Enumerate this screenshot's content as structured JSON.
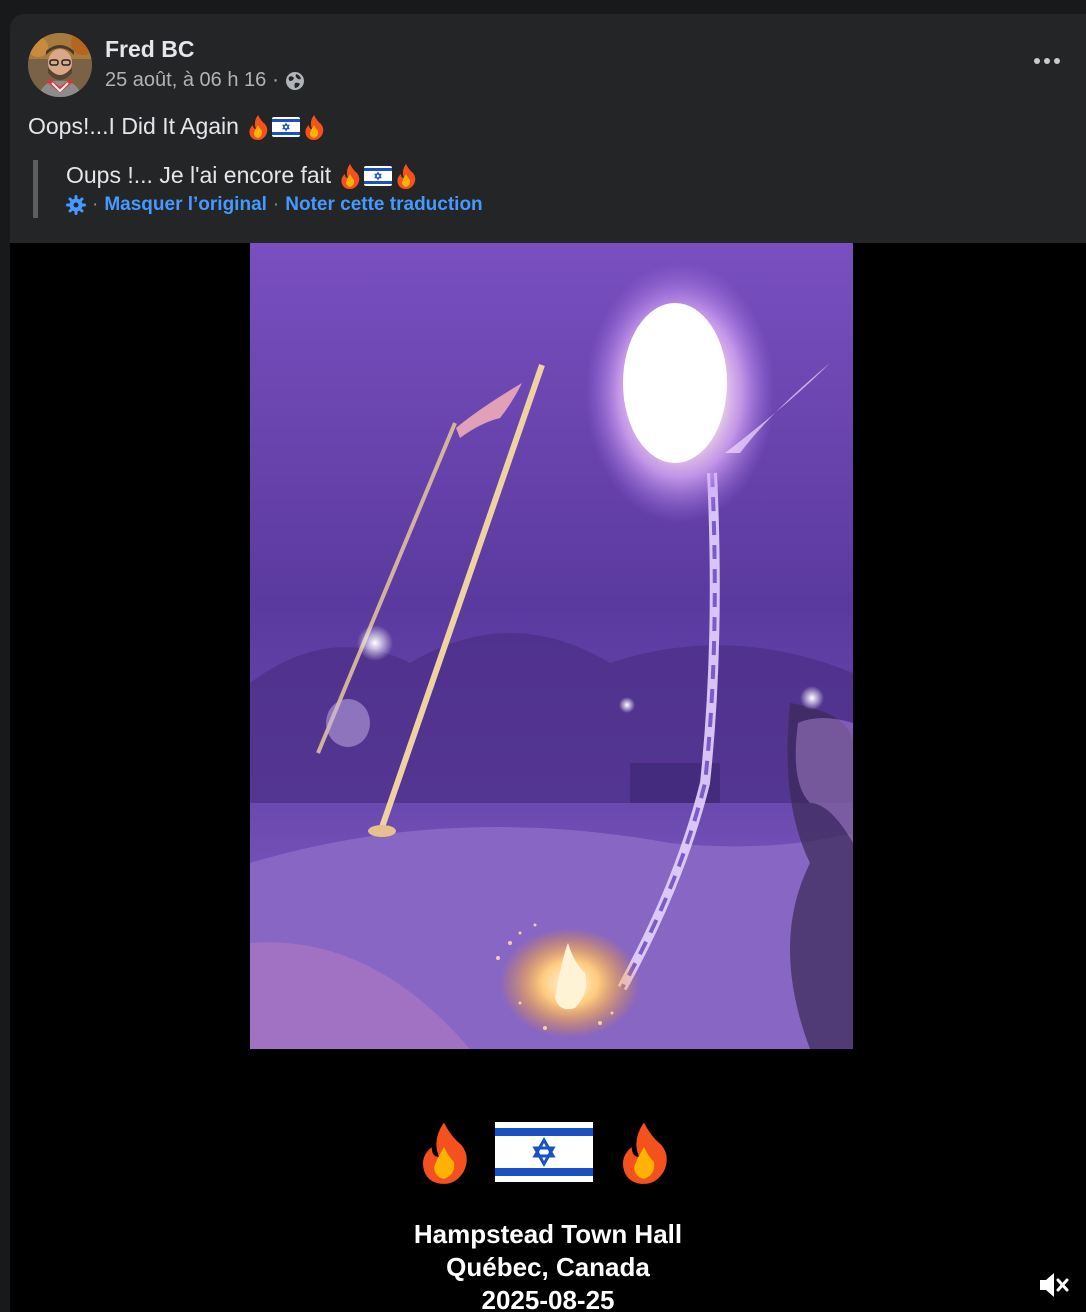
{
  "post": {
    "author": "Fred BC",
    "timestamp": "25 août, à 06 h 16",
    "separator": "·",
    "audience_icon": "globe-icon",
    "text": "Oops!...I Did It Again",
    "text_emojis": [
      "fire",
      "israel-flag",
      "fire"
    ]
  },
  "translation": {
    "text": "Oups !... Je l'ai encore fait",
    "settings_icon": "gear-icon",
    "separator": "·",
    "hide_original": "Masquer l’original",
    "rate_translation": "Noter cette traduction"
  },
  "video": {
    "overlay_emojis": [
      "fire",
      "israel-flag",
      "fire"
    ],
    "caption_line1": "Hampstead Town Hall",
    "caption_line2": "Québec, Canada",
    "caption_line3": "2025-08-25",
    "mute_icon": "muted-speaker-icon"
  },
  "colors": {
    "card_bg": "#242526",
    "link_blue": "#4599ff",
    "text_primary": "#e4e6eb",
    "text_secondary": "#b0b3b8",
    "photo_purple": "#6b43a8"
  }
}
